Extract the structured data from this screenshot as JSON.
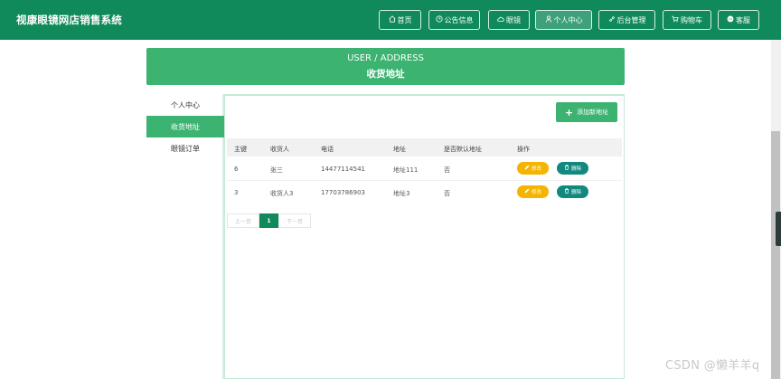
{
  "header": {
    "brand": "视康眼镜网店销售系统",
    "nav": [
      {
        "label": "首页",
        "icon": "home-icon"
      },
      {
        "label": "公告信息",
        "icon": "clock-icon"
      },
      {
        "label": "眼镜",
        "icon": "cloud-icon"
      },
      {
        "label": "个人中心",
        "icon": "user-icon"
      },
      {
        "label": "后台管理",
        "icon": "link-icon"
      },
      {
        "label": "购物车",
        "icon": "cart-icon"
      },
      {
        "label": "客服",
        "icon": "chat-icon"
      }
    ]
  },
  "banner": {
    "title_en": "USER / ADDRESS",
    "title_cn": "收货地址"
  },
  "side_menu": {
    "items": [
      {
        "label": "个人中心"
      },
      {
        "label": "收货地址"
      },
      {
        "label": "眼镜订单"
      }
    ]
  },
  "toolbar": {
    "add_label": "添加新地址"
  },
  "table": {
    "headers": [
      "主键",
      "收货人",
      "电话",
      "地址",
      "是否默认地址",
      "操作"
    ],
    "rows": [
      {
        "id": "6",
        "name": "张三",
        "phone": "14477114541",
        "address": "地址111",
        "default": "否"
      },
      {
        "id": "3",
        "name": "收货人3",
        "phone": "17703786903",
        "address": "地址3",
        "default": "否"
      }
    ],
    "edit_label": "修改",
    "delete_label": "删除"
  },
  "pagination": {
    "prev": "上一页",
    "current": "1",
    "next": "下一页"
  },
  "watermark": "CSDN @懒羊羊q",
  "colors": {
    "header": "#108a5b",
    "accent": "#3cb371",
    "edit": "#f4b400",
    "delete": "#12897f"
  }
}
